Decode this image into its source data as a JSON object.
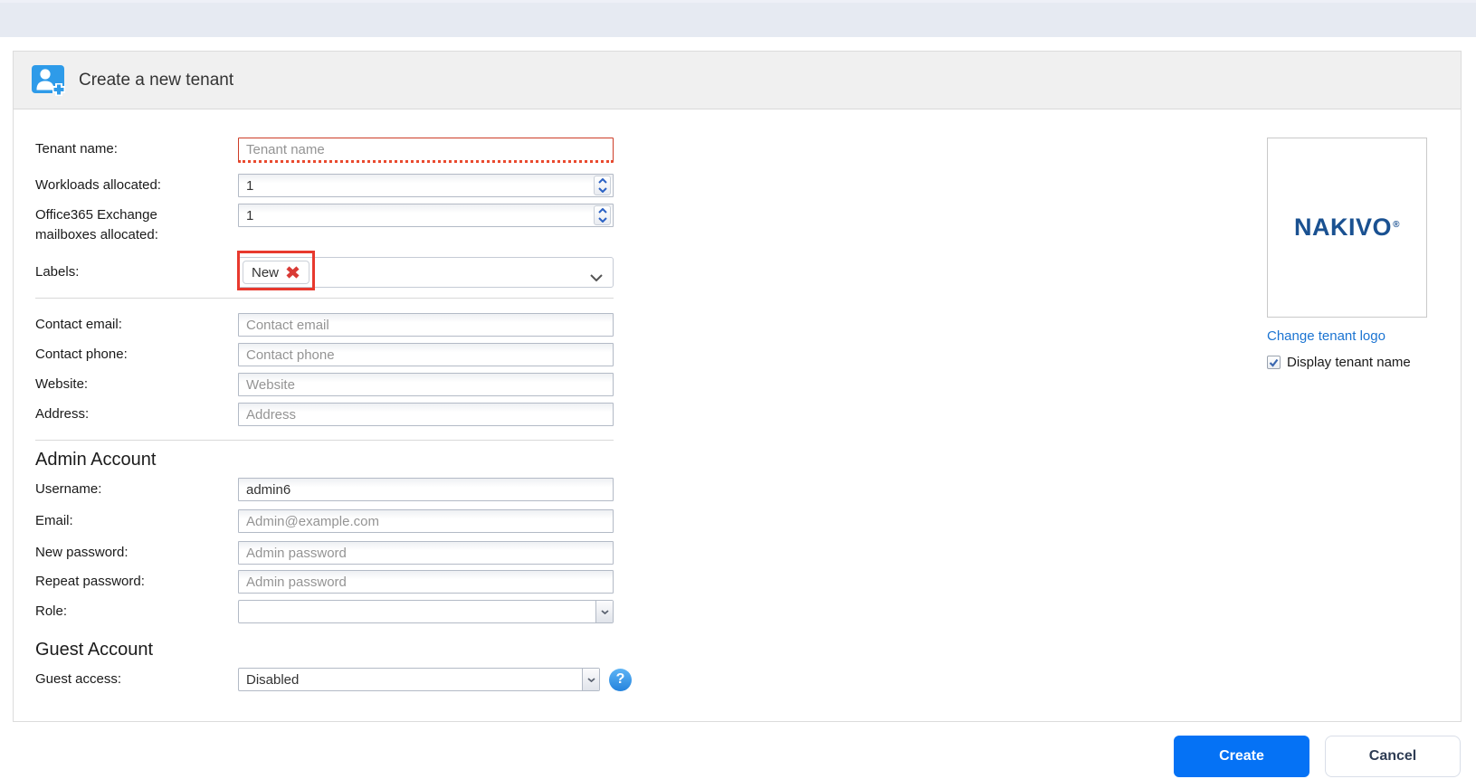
{
  "dialog": {
    "title": "Create a new tenant"
  },
  "form": {
    "tenant_name": {
      "label": "Tenant name:",
      "placeholder": "Tenant name"
    },
    "workloads_allocated": {
      "label": "Workloads allocated:",
      "value": "1"
    },
    "office365_mailboxes": {
      "label": "Office365 Exchange mailboxes allocated:",
      "value": "1"
    },
    "labels": {
      "label": "Labels:",
      "selected_tag": "New"
    },
    "contact_email": {
      "label": "Contact email:",
      "placeholder": "Contact email"
    },
    "contact_phone": {
      "label": "Contact phone:",
      "placeholder": "Contact phone"
    },
    "website": {
      "label": "Website:",
      "placeholder": "Website"
    },
    "address": {
      "label": "Address:",
      "placeholder": "Address"
    }
  },
  "admin_account": {
    "section_title": "Admin Account",
    "username": {
      "label": "Username:",
      "value": "admin6"
    },
    "email": {
      "label": "Email:",
      "placeholder": "Admin@example.com"
    },
    "new_password": {
      "label": "New password:",
      "placeholder": "Admin password"
    },
    "repeat_password": {
      "label": "Repeat password:",
      "placeholder": "Admin password"
    },
    "role": {
      "label": "Role:",
      "value": ""
    }
  },
  "guest_account": {
    "section_title": "Guest Account",
    "guest_access": {
      "label": "Guest access:",
      "value": "Disabled"
    },
    "help_glyph": "?"
  },
  "branding": {
    "logo_text": "NAKIVO",
    "logo_registered_mark": "®",
    "change_logo_link": "Change tenant logo",
    "display_tenant_name": {
      "label": "Display tenant name",
      "checked": true
    }
  },
  "footer": {
    "create_button": "Create",
    "cancel_button": "Cancel"
  },
  "colors": {
    "accent_blue": "#0572f5",
    "icon_blue": "#2e9be9",
    "logo_blue": "#1a5191",
    "link_blue": "#1b74d2",
    "annotation_red": "#e8392e",
    "topbar": "#e6eaf2"
  }
}
